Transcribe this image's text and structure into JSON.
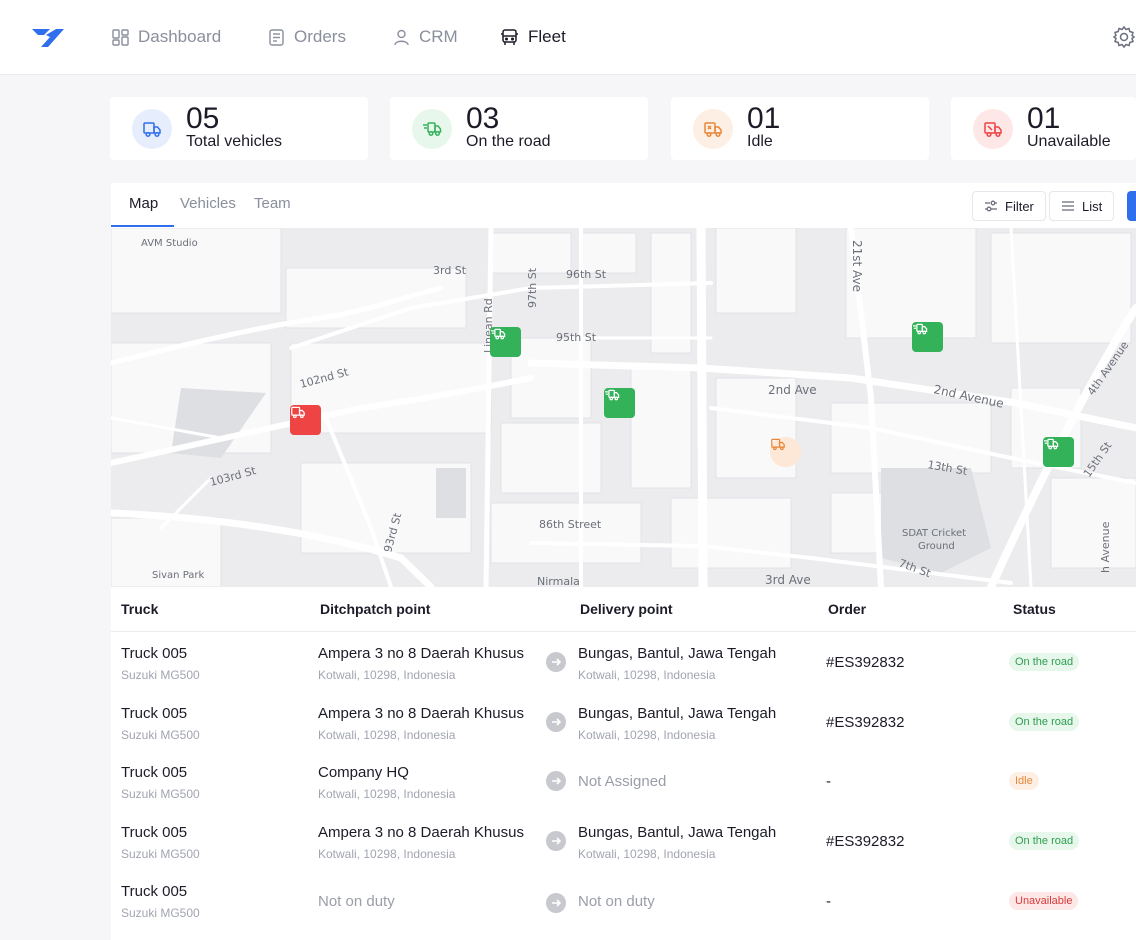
{
  "nav": {
    "items": [
      {
        "label": "Dashboard",
        "icon": "dashboard-icon",
        "active": false
      },
      {
        "label": "Orders",
        "icon": "orders-icon",
        "active": false
      },
      {
        "label": "CRM",
        "icon": "user-icon",
        "active": false
      },
      {
        "label": "Fleet",
        "icon": "bus-icon",
        "active": true
      }
    ]
  },
  "stats": [
    {
      "value": "05",
      "label": "Total vehicles",
      "color": "#2f6fed",
      "bg": "#e6eefd"
    },
    {
      "value": "03",
      "label": "On the road",
      "color": "#34b25a",
      "bg": "#e7f7ec"
    },
    {
      "value": "01",
      "label": "Idle",
      "color": "#e8873a",
      "bg": "#fdefe3"
    },
    {
      "value": "01",
      "label": "Unavailable",
      "color": "#ef4444",
      "bg": "#fde7e7"
    }
  ],
  "tabs": [
    {
      "label": "Map",
      "active": true
    },
    {
      "label": "Vehicles",
      "active": false
    },
    {
      "label": "Team",
      "active": false
    }
  ],
  "toolbar": {
    "filter_label": "Filter",
    "list_label": "List"
  },
  "map": {
    "labels": {
      "avm": "AVM Studio",
      "s3rd": "3rd St",
      "s96": "96th St",
      "s97": "97th St",
      "linean": "Linean Rd",
      "s95": "95th St",
      "s102": "102nd St",
      "ave2a": "2nd Ave",
      "ave2b": "2nd Avenue",
      "ave21": "21st Ave",
      "ave4": "4th Avenue",
      "s103": "103rd St",
      "s13": "13th St",
      "s15": "15th St",
      "s93": "93rd St",
      "s86": "86th Street",
      "sdat1": "SDAT Cricket",
      "sdat2": "Ground",
      "sivan": "Sivan Park",
      "nirmala": "Nirmala",
      "ave3": "3rd Ave",
      "s7": "7th St",
      "ave_r": "h Avenue"
    },
    "colors": {
      "on_road": "#34b25a",
      "unavailable": "#ef4444",
      "idle": "#fde8d8"
    }
  },
  "table": {
    "headers": [
      "Truck",
      "Ditchpatch point",
      "Delivery point",
      "Order",
      "Status"
    ],
    "rows": [
      {
        "truck": "Truck 005",
        "model": "Suzuki MG500",
        "dispatch": "Ampera 3 no 8 Daerah Khusus",
        "dispatch_sub": "Kotwali, 10298, Indonesia",
        "delivery": "Bungas, Bantul, Jawa Tengah",
        "delivery_sub": "Kotwali, 10298, Indonesia",
        "order": "#ES392832",
        "status": "On the road"
      },
      {
        "truck": "Truck 005",
        "model": "Suzuki MG500",
        "dispatch": "Ampera 3 no 8 Daerah Khusus",
        "dispatch_sub": "Kotwali, 10298, Indonesia",
        "delivery": "Bungas, Bantul, Jawa Tengah",
        "delivery_sub": "Kotwali, 10298, Indonesia",
        "order": "#ES392832",
        "status": "On the road"
      },
      {
        "truck": "Truck 005",
        "model": "Suzuki MG500",
        "dispatch": "Company HQ",
        "dispatch_sub": "Kotwali, 10298, Indonesia",
        "delivery": "Not Assigned",
        "delivery_sub": "",
        "order": "-",
        "status": "Idle"
      },
      {
        "truck": "Truck 005",
        "model": "Suzuki MG500",
        "dispatch": "Ampera 3 no 8 Daerah Khusus",
        "dispatch_sub": "Kotwali, 10298, Indonesia",
        "delivery": "Bungas, Bantul, Jawa Tengah",
        "delivery_sub": "Kotwali, 10298, Indonesia",
        "order": "#ES392832",
        "status": "On the road"
      },
      {
        "truck": "Truck 005",
        "model": "Suzuki MG500",
        "dispatch": "Not on duty",
        "dispatch_sub": "",
        "delivery": "Not on duty",
        "delivery_sub": "",
        "order": "-",
        "status": "Unavailable"
      }
    ]
  }
}
